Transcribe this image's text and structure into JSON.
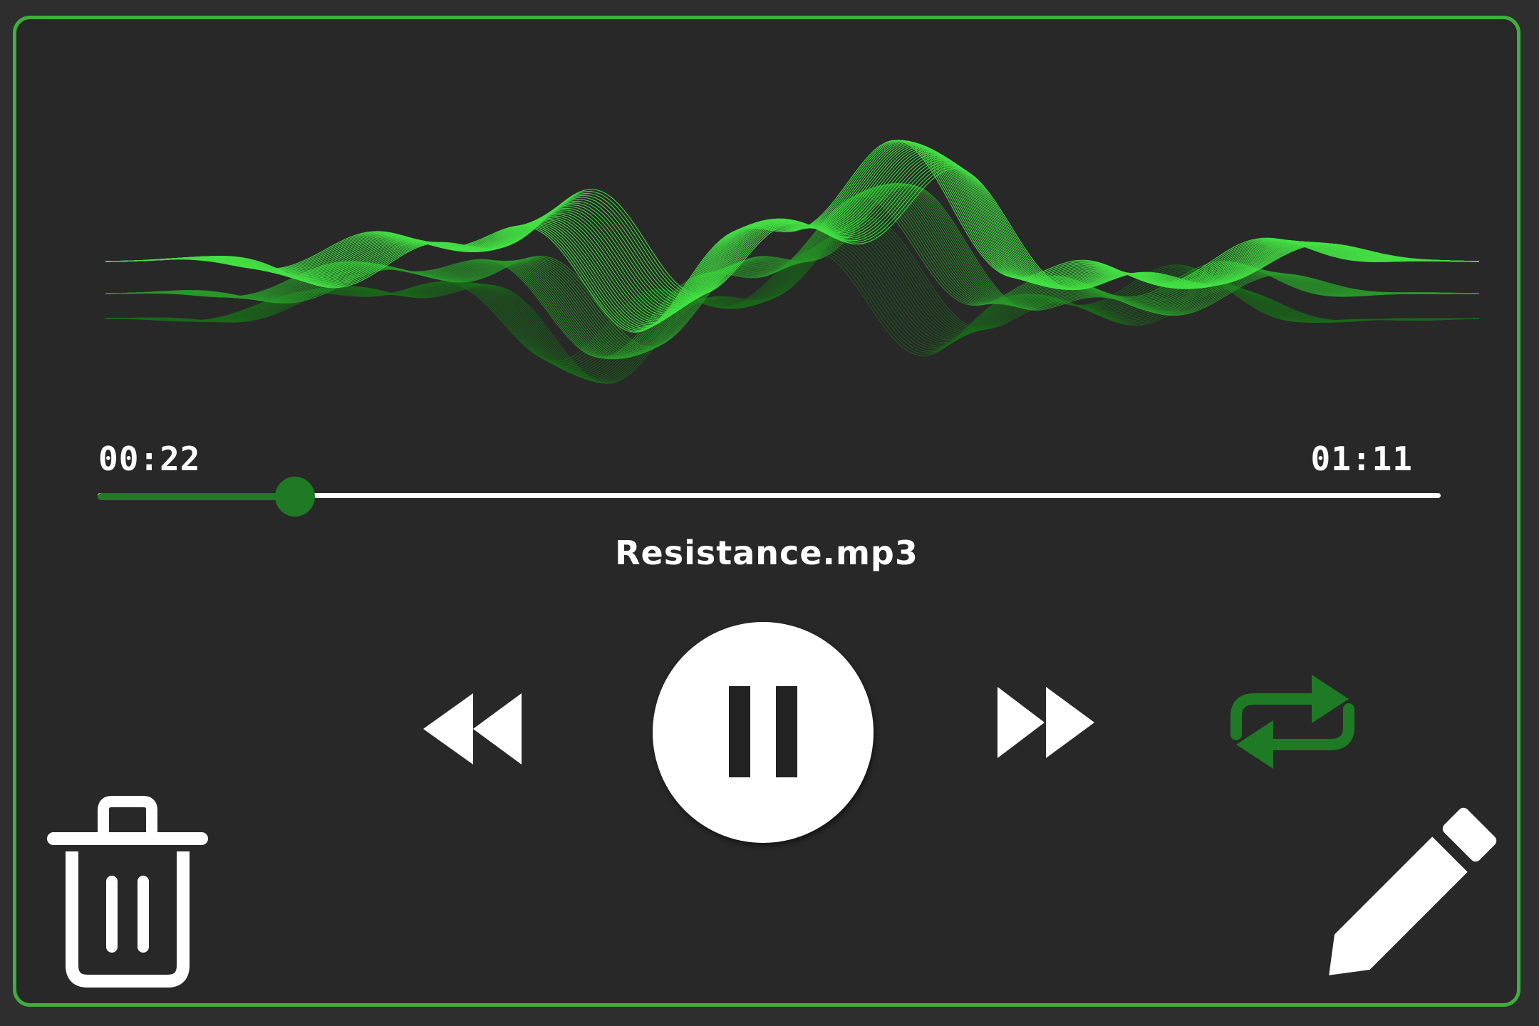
{
  "player": {
    "track_title": "Resistance.mp3",
    "time_elapsed": "00:22",
    "time_total": "01:11",
    "progress_fraction": 0.147,
    "is_playing": true,
    "repeat_enabled": true
  },
  "icons": {
    "rewind": "rewind-icon",
    "play_pause": "pause-icon",
    "fast_forward": "fast-forward-icon",
    "repeat": "repeat-icon",
    "delete": "trash-icon",
    "edit": "pencil-icon"
  },
  "colors": {
    "background": "#282828",
    "border": "#3fae3f",
    "accent": "#1e7a24",
    "wave_bright": "#44e044",
    "wave_dark": "#1a6a1a",
    "foreground": "#ffffff"
  }
}
